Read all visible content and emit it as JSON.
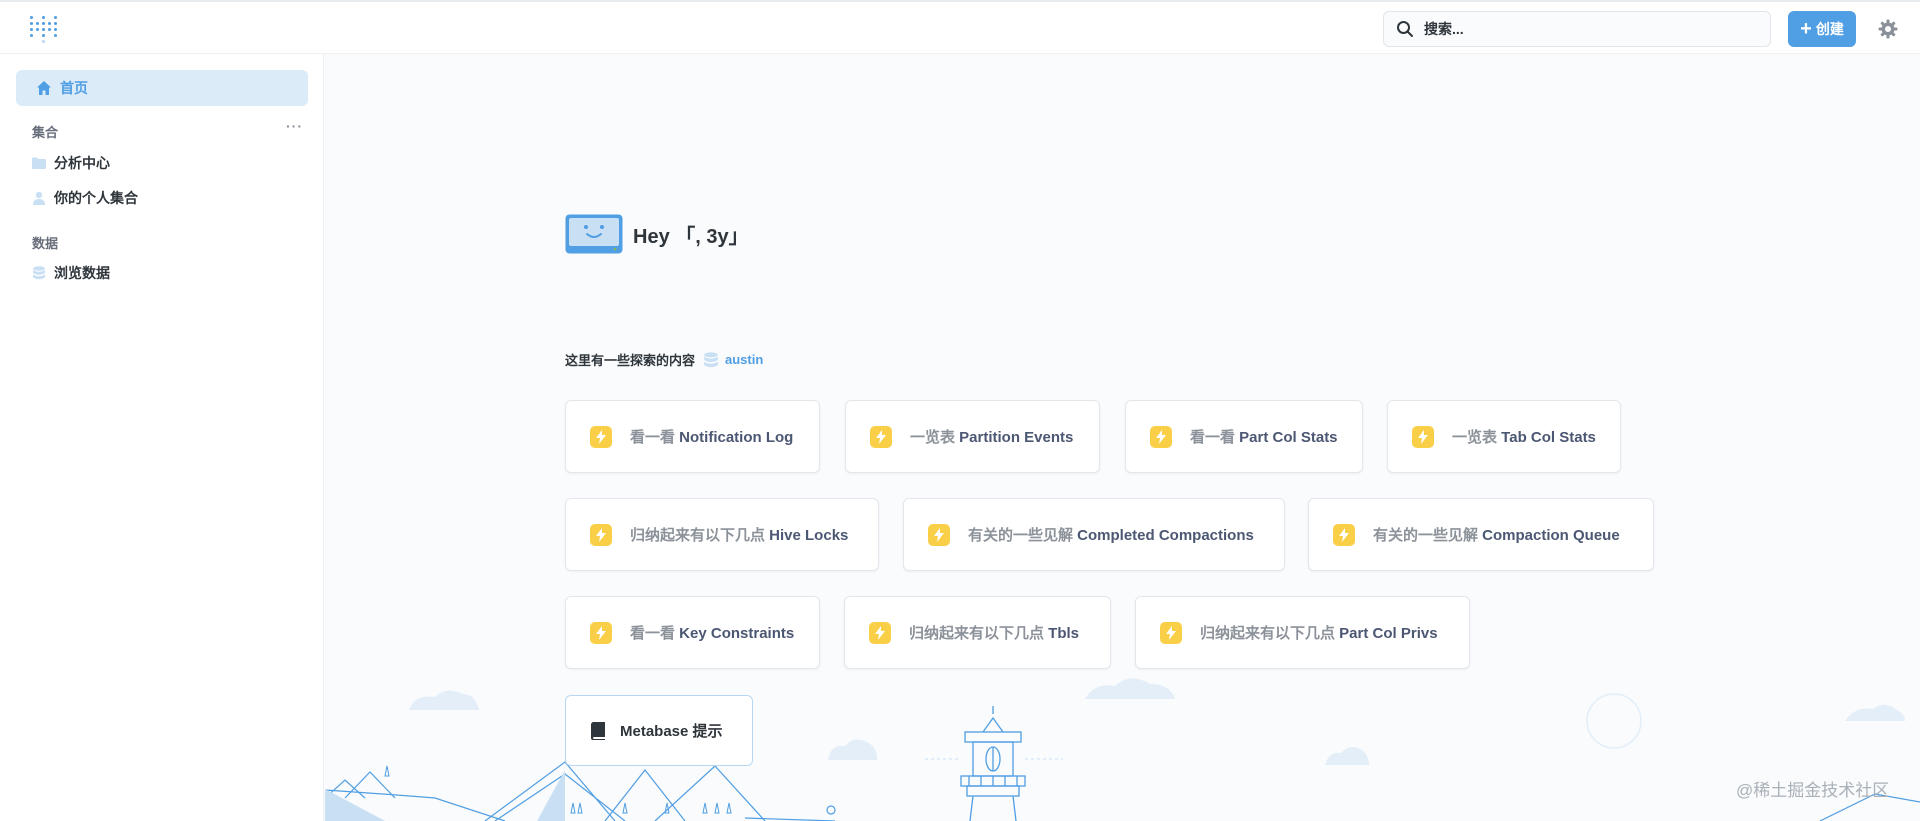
{
  "app": {
    "name": "Metabase"
  },
  "colors": {
    "brand": "#509ee3",
    "bolt": "#f9cf48",
    "text": "#2e353b",
    "muted": "#8c929a"
  },
  "header": {
    "search_placeholder": "搜索...",
    "create_label": "创建"
  },
  "sidebar": {
    "home_label": "首页",
    "collections_heading": "集合",
    "more_label": "···",
    "collections": [
      {
        "label": "分析中心",
        "icon": "folder-icon"
      },
      {
        "label": "你的个人集合",
        "icon": "person-icon"
      }
    ],
    "data_heading": "数据",
    "data_items": [
      {
        "label": "浏览数据",
        "icon": "database-icon"
      }
    ]
  },
  "main": {
    "greeting": "Hey 「, 3y」",
    "explore_text": "这里有一些探索的内容",
    "database_name": "austin",
    "cards": [
      {
        "prefix": "看一看 ",
        "name": "Notification Log"
      },
      {
        "prefix": "一览表 ",
        "name": "Partition Events"
      },
      {
        "prefix": "看一看 ",
        "name": "Part Col Stats"
      },
      {
        "prefix": "一览表 ",
        "name": "Tab Col Stats"
      },
      {
        "prefix": "归纳起来有以下几点 ",
        "name": "Hive Locks"
      },
      {
        "prefix": "有关的一些见解 ",
        "name": "Completed Compactions"
      },
      {
        "prefix": "有关的一些见解 ",
        "name": "Compaction Queue"
      },
      {
        "prefix": "看一看 ",
        "name": "Key Constraints"
      },
      {
        "prefix": "归纳起来有以下几点 ",
        "name": "Tbls"
      },
      {
        "prefix": "归纳起来有以下几点 ",
        "name": "Part Col Privs"
      }
    ],
    "tip_label": "Metabase 提示"
  },
  "watermark": "@稀土掘金技术社区"
}
